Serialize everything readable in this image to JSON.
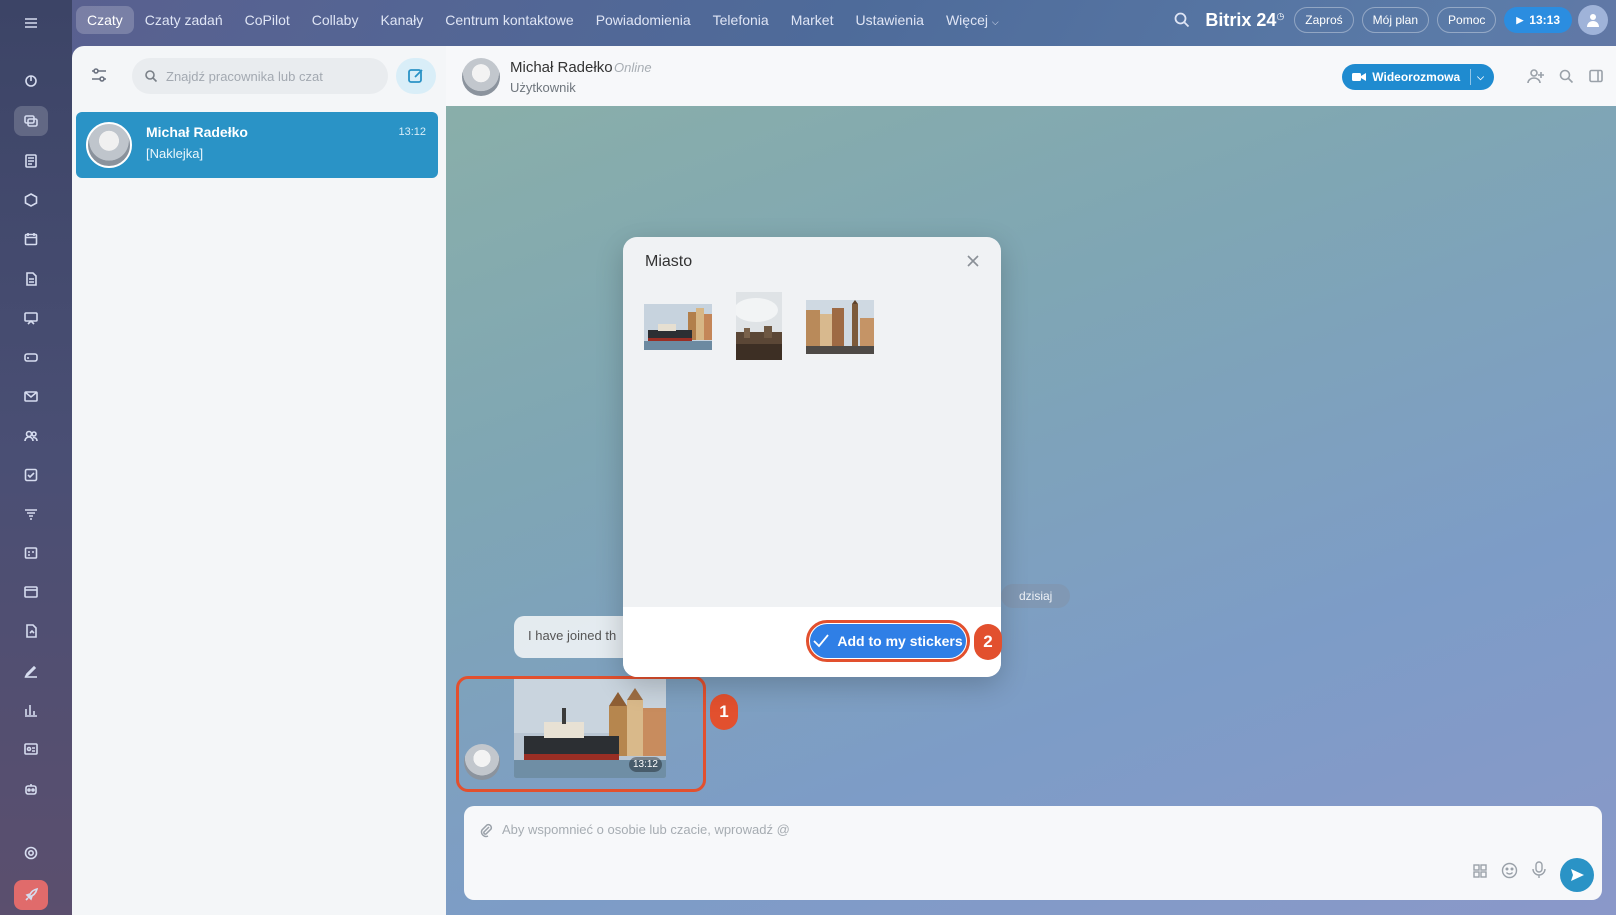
{
  "nav": {
    "tabs": [
      "Czaty",
      "Czaty zadań",
      "CoPilot",
      "Collaby",
      "Kanały",
      "Centrum kontaktowe",
      "Powiadomienia",
      "Telefonia",
      "Market",
      "Ustawienia",
      "Więcej"
    ],
    "active_tab": "Czaty",
    "logo": "Bitrix 24",
    "invite": "Zaproś",
    "my_plan": "Mój plan",
    "help": "Pomoc",
    "clock": "13:13"
  },
  "chat_list": {
    "search_placeholder": "Znajdź pracownika lub czat",
    "items": [
      {
        "name": "Michał Radełko",
        "last_message": "[Naklejka]",
        "time": "13:12"
      }
    ]
  },
  "chat": {
    "header_name": "Michał Radełko",
    "header_status": "Online",
    "header_subtitle": "Użytkownik",
    "video_button": "Wideorozmowa",
    "date_divider": "dzisiaj",
    "system_message": "I have joined th",
    "sticker_time": "13:12",
    "composer_placeholder": "Aby wspomnieć o osobie lub czacie, wprowadź @"
  },
  "modal": {
    "title": "Miasto",
    "add_button": "Add to my stickers"
  },
  "annotations": {
    "step1": "1",
    "step2": "2"
  },
  "colors": {
    "accent": "#2a93c6",
    "add_button": "#2f7fe6",
    "highlight": "#e2502e"
  }
}
